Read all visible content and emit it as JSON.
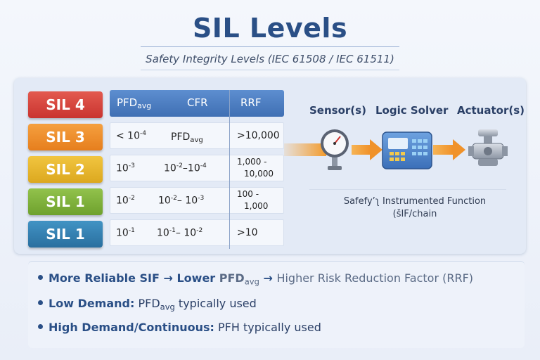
{
  "title": "SIL Levels",
  "subtitle": "Safety Integrity Levels (IEC 61508 / IEC 61511)",
  "colors": {
    "sil4": "#d8423c",
    "sil3": "#ee8a26",
    "sil2": "#e9b72a",
    "sil1_green": "#7fb23a",
    "sil1_blue": "#2f7db0",
    "header_blue": "#3f6fb3",
    "arrow_orange": "#f3a23a"
  },
  "sil_labels": [
    "SIL 4",
    "SIL 3",
    "SIL 2",
    "SIL 1",
    "SIL 1"
  ],
  "table": {
    "headers": {
      "pfd_main": "PFD",
      "pfd_sub": "avg",
      "cfr": "CFR",
      "rrf": "RRF"
    },
    "rows": [
      {
        "pfd_base": "< 10",
        "pfd_exp": "-4",
        "mid_main": "PFD",
        "mid_sub": "avg",
        "rrf": ">10,000"
      },
      {
        "pfd_base": "10",
        "pfd_exp": "-3",
        "mid_a": "10",
        "mid_a_exp": "-2",
        "mid_dash": "–",
        "mid_b": "10",
        "mid_b_exp": "-4",
        "rrf_l1": "1,000 -",
        "rrf_l2": "10,000"
      },
      {
        "pfd_base": "10",
        "pfd_exp": "-2",
        "mid_a": "10",
        "mid_a_exp": "-2",
        "mid_dash": "– ",
        "mid_b": "10",
        "mid_b_exp": "-3",
        "rrf_l1": "100 -",
        "rrf_l2": "1,000"
      },
      {
        "pfd_base": "10",
        "pfd_exp": "-1",
        "mid_a": "10",
        "mid_a_exp": "-1",
        "mid_dash": "– ",
        "mid_b": "10",
        "mid_b_exp": "-2",
        "rrf": ">10"
      }
    ]
  },
  "flow": {
    "sensor_label": "Sensor(s)",
    "logic_label": "Logic Solver",
    "actuator_label": "Actuator(s)",
    "caption_line1": "Safefy’ʅ Instrumented Function",
    "caption_line2": "(šIF/chain"
  },
  "bullets": {
    "b1_bold": "More Reliable SIF",
    "b1_arrow1": " → ",
    "b1_lower": "Lower ",
    "b1_pfd": "PFD",
    "b1_sub": "avg",
    "b1_arrow2": " → ",
    "b1_rest": "Higher Risk Reduction Factor (RRF)",
    "b2_bold": "Low Demand:",
    "b2_pfd": " PFD",
    "b2_sub": "avg",
    "b2_rest": "  typically used",
    "b3_bold": "High Demand/Continuous:",
    "b3_rest": " PFH typically used"
  }
}
